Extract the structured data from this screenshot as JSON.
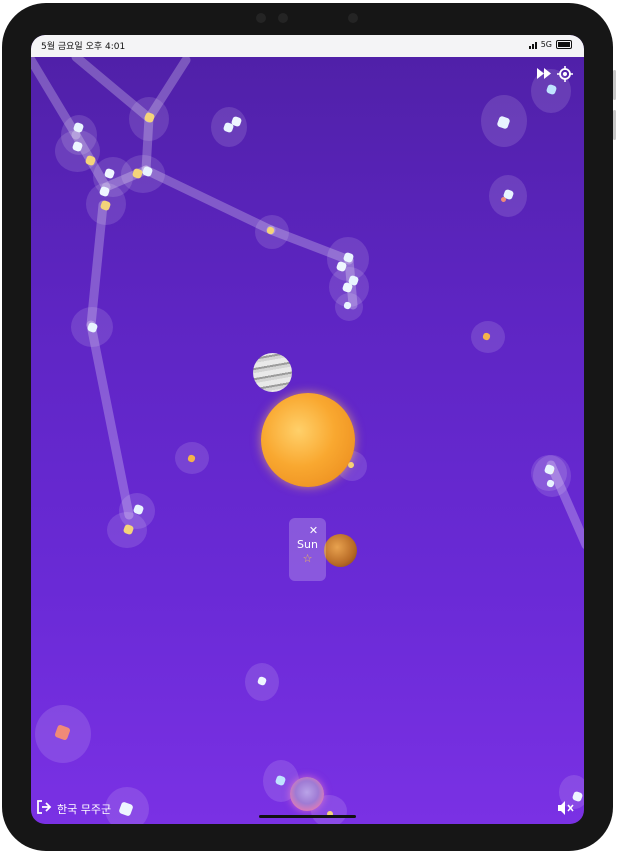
{
  "status_bar": {
    "time": "5월 금요일 오후 4:01",
    "network": "5G"
  },
  "hud": {
    "fast_forward_icon": "fast-forward-icon",
    "locate_icon": "crosshair-icon",
    "mute_icon": "speaker-muted-icon"
  },
  "selected_object": {
    "name": "Sun",
    "close_symbol": "✕",
    "favorite_symbol": "☆"
  },
  "footer": {
    "constellation_label": "한국 무주군",
    "exit_icon": "exit-icon"
  },
  "colors": {
    "background_top": "#4f20a6",
    "background_bottom": "#7a31e4",
    "star_white": "#e8f4ff",
    "star_yellow": "#f4d47a",
    "star_red": "#f08a78",
    "constellation_line": "rgba(255,255,255,0.25)"
  }
}
